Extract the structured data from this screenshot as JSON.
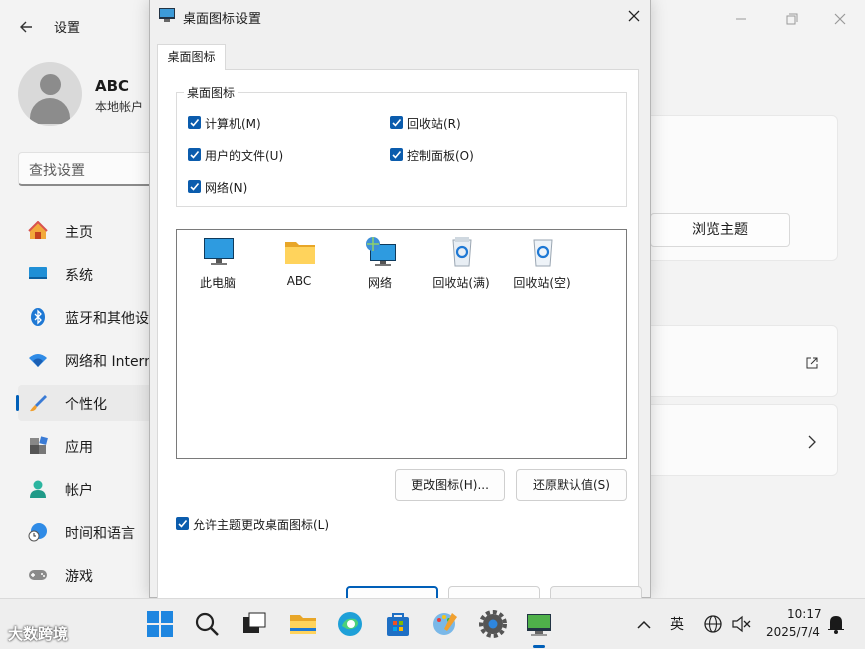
{
  "settings": {
    "app_title": "设置",
    "user": {
      "name": "ABC",
      "account_type": "本地帐户"
    },
    "search_placeholder": "查找设置",
    "nav": [
      {
        "label": "主页"
      },
      {
        "label": "系统"
      },
      {
        "label": "蓝牙和其他设"
      },
      {
        "label": "网络和 Intern"
      },
      {
        "label": "个性化"
      },
      {
        "label": "应用"
      },
      {
        "label": "帐户"
      },
      {
        "label": "时间和语言"
      },
      {
        "label": "游戏"
      }
    ],
    "browse_themes_label": "浏览主题"
  },
  "dialog": {
    "title": "桌面图标设置",
    "tab_label": "桌面图标",
    "group_label": "桌面图标",
    "checkboxes": [
      {
        "label": "计算机(M)",
        "checked": true
      },
      {
        "label": "回收站(R)",
        "checked": true
      },
      {
        "label": "用户的文件(U)",
        "checked": true
      },
      {
        "label": "控制面板(O)",
        "checked": true
      },
      {
        "label": "网络(N)",
        "checked": true
      }
    ],
    "icons": [
      {
        "label": "此电脑",
        "icon": "monitor-icon"
      },
      {
        "label": "ABC",
        "icon": "folder-icon"
      },
      {
        "label": "网络",
        "icon": "network-icon"
      },
      {
        "label": "回收站(满)",
        "icon": "recycle-bin-full-icon"
      },
      {
        "label": "回收站(空)",
        "icon": "recycle-bin-empty-icon"
      }
    ],
    "change_icon_label": "更改图标(H)...",
    "restore_default_label": "还原默认值(S)",
    "allow_themes_label": "允许主题更改桌面图标(L)",
    "allow_themes_checked": true
  },
  "taskbar": {
    "ime_label": "英",
    "time": "10:17",
    "date": "2025/7/4",
    "watermark": "大数跨境"
  },
  "colors": {
    "accent": "#005fb8",
    "checkbox": "#0b5cad"
  }
}
